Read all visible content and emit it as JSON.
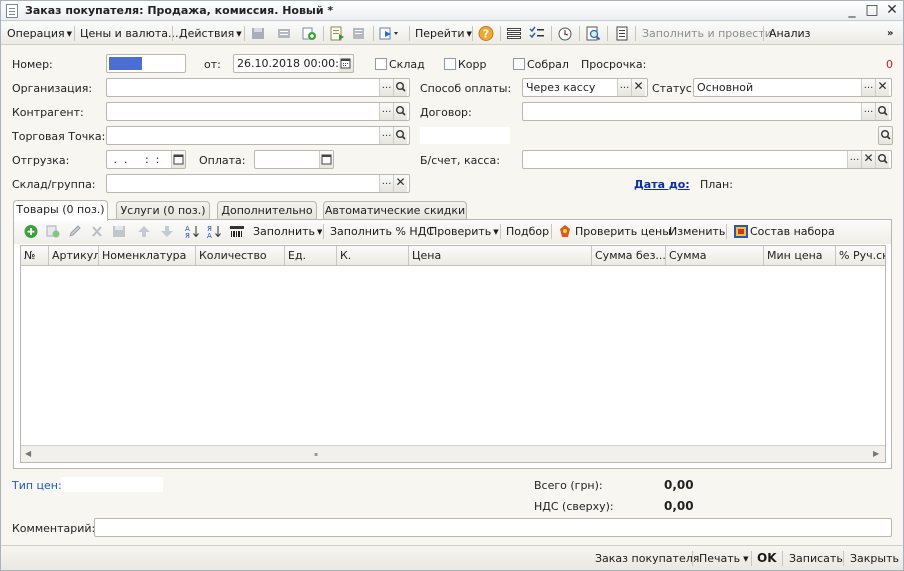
{
  "window": {
    "title": "Заказ покупателя: Продажа, комиссия. Новый *"
  },
  "toolbar": {
    "operation": "Операция",
    "prices_currency": "Цены и валюта...",
    "actions": "Действия",
    "goto": "Перейти",
    "fill_and_post": "Заполнить и провести",
    "analysis": "Анализ"
  },
  "form": {
    "number_label": "Номер:",
    "from_label": "от:",
    "date_value": "26.10.2018 00:00:00",
    "warehouse_check": "Склад",
    "corr_check": "Корр",
    "collected_check": "Собрал",
    "overdue_label": "Просрочка:",
    "overdue_value": "0",
    "organization_label": "Организация:",
    "payment_method_label": "Способ оплаты:",
    "payment_method_value": "Через кассу",
    "status_label": "Статус:",
    "status_value": "Основной",
    "counterparty_label": "Контрагент:",
    "contract_label": "Договор:",
    "trade_point_label": "Торговая Точка:",
    "shipment_label": "Отгрузка:",
    "shipment_value": " .  .     :  :",
    "payment_label": "Оплата:",
    "bank_cash_label": "Б/счет, касса:",
    "warehouse_group_label": "Склад/группа:",
    "date_until_label": "Дата до:",
    "plan_label": "План:"
  },
  "tabs": [
    {
      "label": "Товары (0 поз.)"
    },
    {
      "label": "Услуги (0 поз.)"
    },
    {
      "label": "Дополнительно"
    },
    {
      "label": "Автоматические скидки"
    }
  ],
  "table_toolbar": {
    "fill": "Заполнить",
    "fill_vat": "Заполнить % НДС",
    "check": "Проверить",
    "selection": "Подбор",
    "check_prices": "Проверить цены",
    "change": "Изменить",
    "kit_composition": "Состав набора"
  },
  "table": {
    "columns": [
      "№",
      "Артикул",
      "Номенклатура",
      "Количество",
      "Ед.",
      "К.",
      "Цена",
      "Сумма без...",
      "Сумма",
      "Мин цена",
      "% Руч.ск."
    ]
  },
  "totals": {
    "price_type_label": "Тип цен:",
    "total_label": "Всего (грн):",
    "total_value": "0,00",
    "vat_label": "НДС (сверху):",
    "vat_value": "0,00",
    "comment_label": "Комментарий:"
  },
  "bottom_bar": {
    "customer_order": "Заказ покупателя",
    "print": "Печать",
    "ok": "OK",
    "save": "Записать",
    "close": "Закрыть"
  },
  "colors": {
    "number_field_fill": "#4a6fd1",
    "link_blue": "#0b2eab",
    "overdue_red": "#d11a1a"
  }
}
